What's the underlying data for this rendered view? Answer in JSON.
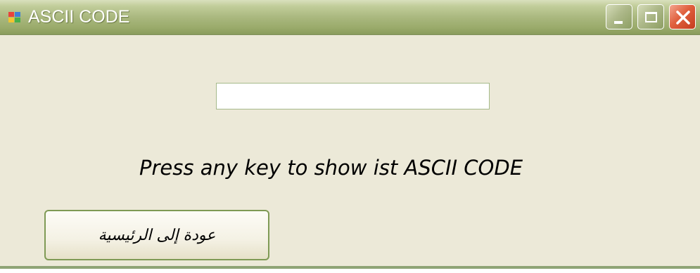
{
  "window": {
    "title": "ASCII CODE",
    "icon": "application-icon",
    "controls": {
      "minimize": "minimize-icon",
      "maximize": "maximize-icon",
      "close": "close-icon"
    }
  },
  "main": {
    "key_input": {
      "value": "",
      "placeholder": ""
    },
    "prompt_text": "Press any key to show ist ASCII CODE",
    "home_button_label": "عودة إلى الرئيسية"
  },
  "colors": {
    "titlebar": "#aab87f",
    "background": "#ece9d8",
    "close_button": "#e0603e",
    "button_border": "#7f9a55"
  }
}
